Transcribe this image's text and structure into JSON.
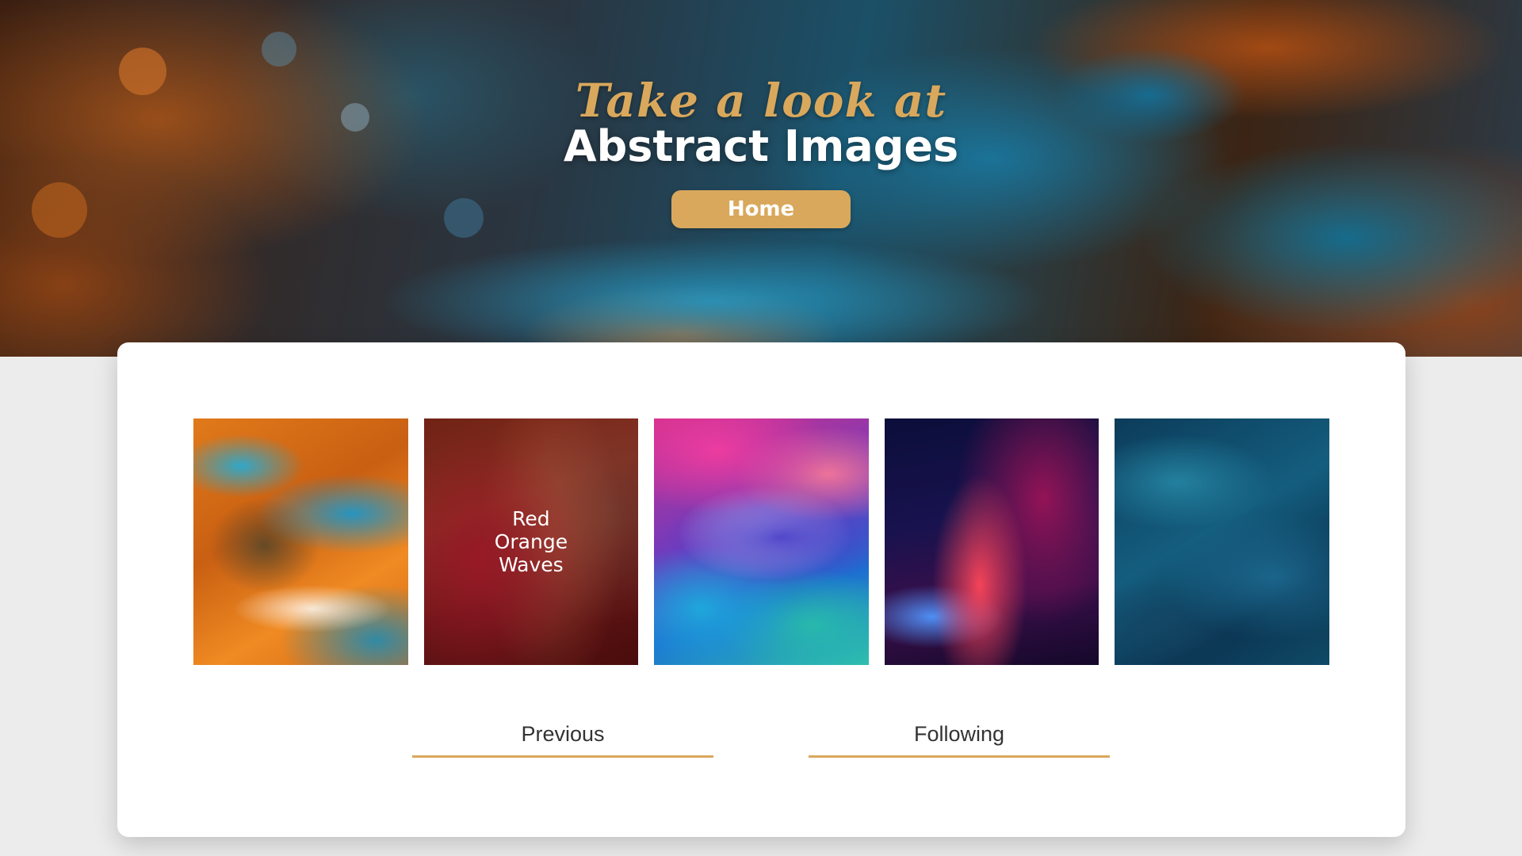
{
  "hero": {
    "script_title": "Take a look at",
    "main_title": "Abstract Images",
    "home_button": "Home"
  },
  "gallery": {
    "items": [
      {
        "name": "orange-blue-abstract",
        "label": ""
      },
      {
        "name": "red-orange-waves",
        "label": "Red\nOrange\nWaves"
      },
      {
        "name": "pink-blue-abstract",
        "label": ""
      },
      {
        "name": "neon-light-abstract",
        "label": ""
      },
      {
        "name": "blue-texture-abstract",
        "label": ""
      }
    ],
    "hovered_caption_lines": [
      "Red",
      "Orange",
      "Waves"
    ]
  },
  "pager": {
    "previous": "Previous",
    "following": "Following"
  },
  "colors": {
    "accent": "#d9a85c",
    "card_bg": "#ffffff",
    "page_bg": "#ececec",
    "text": "#333333"
  }
}
